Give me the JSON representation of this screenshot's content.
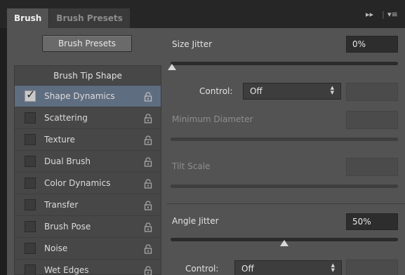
{
  "tabs": [
    {
      "label": "Brush",
      "active": true
    },
    {
      "label": "Brush Presets",
      "active": false
    }
  ],
  "preset_button": "Brush Presets",
  "left_list": {
    "header": "Brush Tip Shape",
    "items": [
      {
        "label": "Shape Dynamics",
        "checked": true,
        "selected": true
      },
      {
        "label": "Scattering",
        "checked": false
      },
      {
        "label": "Texture",
        "checked": false
      },
      {
        "label": "Dual Brush",
        "checked": false
      },
      {
        "label": "Color Dynamics",
        "checked": false
      },
      {
        "label": "Transfer",
        "checked": false
      },
      {
        "label": "Brush Pose",
        "checked": false
      },
      {
        "label": "Noise",
        "checked": false
      },
      {
        "label": "Wet Edges",
        "checked": false
      }
    ]
  },
  "size_jitter": {
    "label": "Size Jitter",
    "value": "0%",
    "level": 0
  },
  "control_1": {
    "label": "Control:",
    "value": "Off"
  },
  "minimum_diameter": {
    "label": "Minimum Diameter",
    "value": ""
  },
  "tilt_scale": {
    "label": "Tilt Scale",
    "value": ""
  },
  "angle_jitter": {
    "label": "Angle Jitter",
    "value": "50%",
    "level": 0.5
  },
  "control_2": {
    "label": "Control:",
    "value": "Off"
  },
  "colors": {
    "panel": "#535353",
    "selection": "#5f6d80",
    "field": "#2d2d2d"
  }
}
